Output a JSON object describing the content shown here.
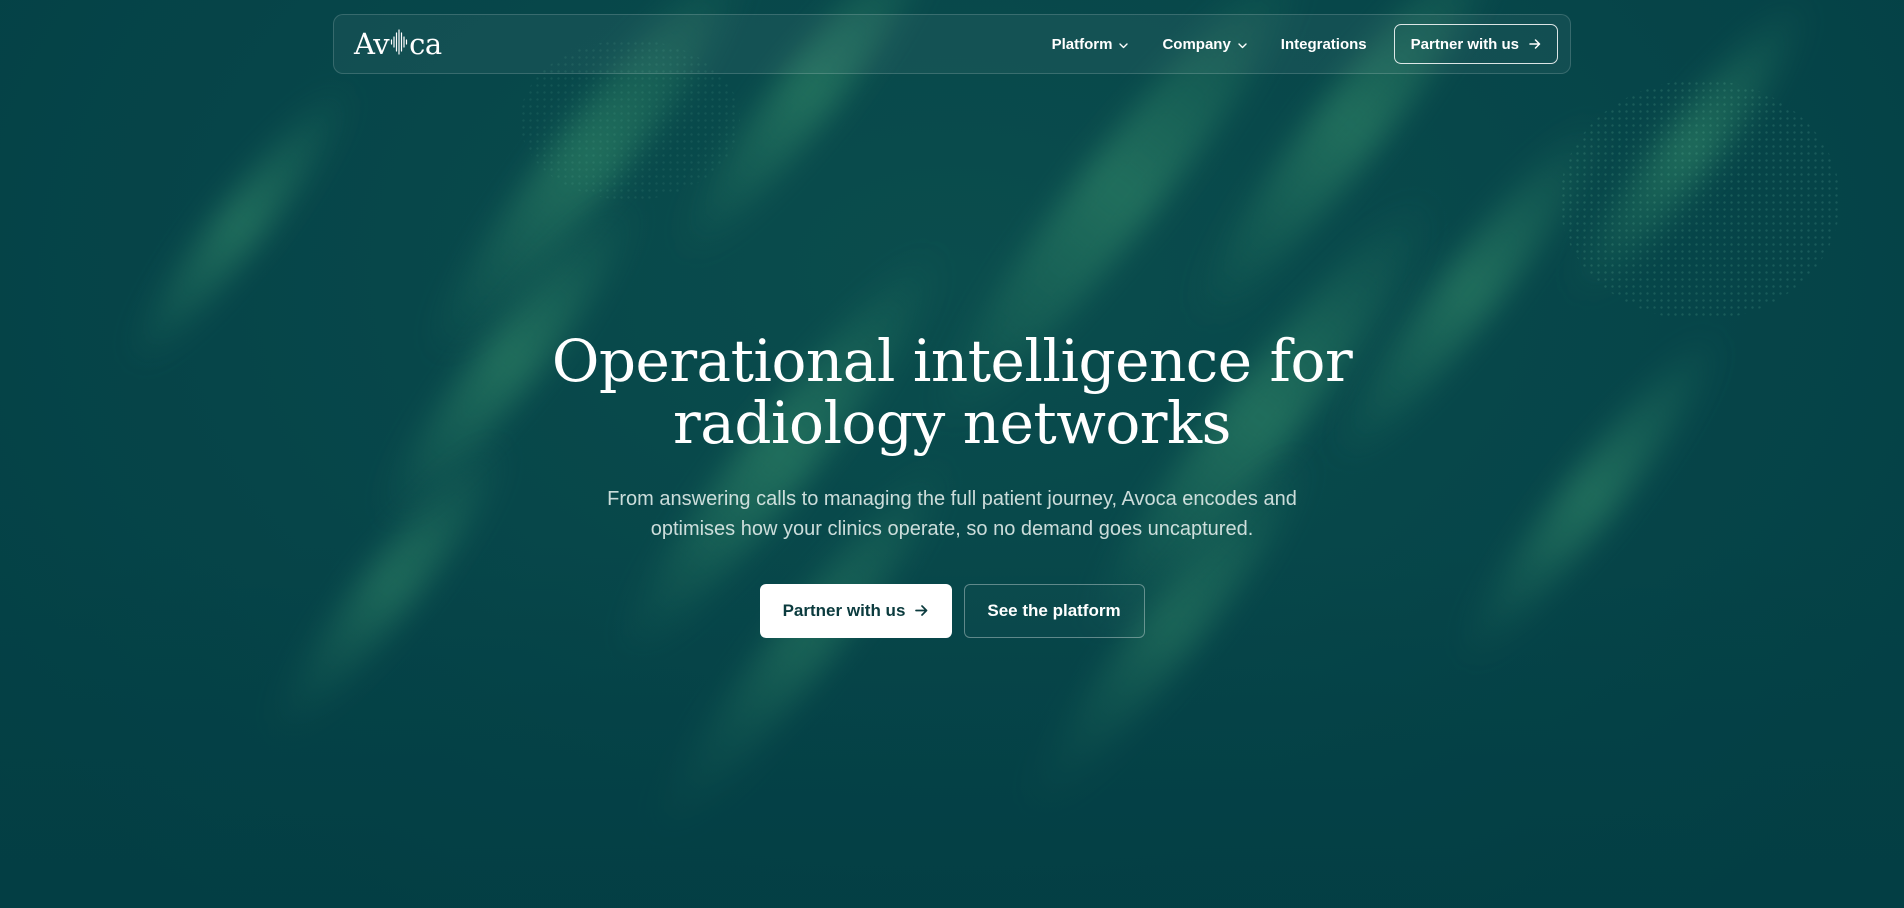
{
  "brand": {
    "logo_prefix": "Av",
    "logo_suffix": "ca"
  },
  "nav": {
    "items": [
      {
        "label": "Platform",
        "has_dropdown": true
      },
      {
        "label": "Company",
        "has_dropdown": true
      },
      {
        "label": "Integrations",
        "has_dropdown": false
      }
    ],
    "cta_label": "Partner with us"
  },
  "hero": {
    "title_line1": "Operational intelligence for",
    "title_line2": "radiology networks",
    "subtitle_line1": "From answering calls to managing the full patient journey, Avoca encodes and",
    "subtitle_line2": "optimises how your clinics operate, so no demand goes uncaptured.",
    "primary_cta": "Partner with us",
    "secondary_cta": "See the platform"
  },
  "icons": {
    "dropdown": "chevron-down-icon",
    "arrow": "arrow-right-icon",
    "logo_mark": "waveform-icon"
  },
  "colors": {
    "background": "#054448",
    "accent_streak": "#348c6a",
    "text_primary": "#ffffff",
    "button_text_dark": "#0b3b3e"
  }
}
